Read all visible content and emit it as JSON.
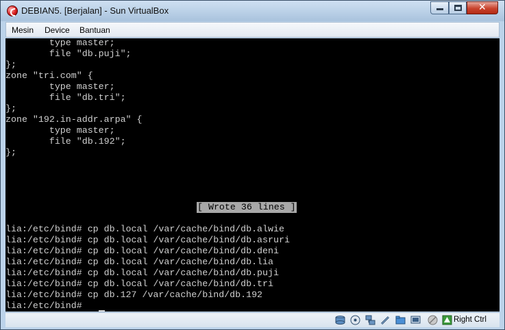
{
  "window": {
    "title": "DEBIAN5. [Berjalan] - Sun VirtualBox"
  },
  "menu": {
    "items": [
      "Mesin",
      "Device",
      "Bantuan"
    ]
  },
  "terminal": {
    "lines": [
      "        type master;",
      "        file \"db.puji\";",
      "};",
      "zone \"tri.com\" {",
      "        type master;",
      "        file \"db.tri\";",
      "};",
      "zone \"192.in-addr.arpa\" {",
      "        type master;",
      "        file \"db.192\";",
      "};"
    ],
    "status_message": "[ Wrote 36 lines ]",
    "commands": [
      "lia:/etc/bind# cp db.local /var/cache/bind/db.alwie",
      "lia:/etc/bind# cp db.local /var/cache/bind/db.asruri",
      "lia:/etc/bind# cp db.local /var/cache/bind/db.deni",
      "lia:/etc/bind# cp db.local /var/cache/bind/db.lia",
      "lia:/etc/bind# cp db.local /var/cache/bind/db.puji",
      "lia:/etc/bind# cp db.local /var/cache/bind/db.tri",
      "lia:/etc/bind# cp db.127 /var/cache/bind/db.192",
      "lia:/etc/bind# "
    ]
  },
  "statusbar": {
    "icons": [
      "hard-disk-icon",
      "cd-dvd-icon",
      "network-icon",
      "usb-icon",
      "shared-folders-icon",
      "screen-icon",
      "mouse-integration-icon",
      "host-key-icon"
    ],
    "host_key": "Right Ctrl"
  },
  "colors": {
    "terminal_bg": "#000000",
    "terminal_fg": "#cfcfcf",
    "highlight_bg": "#a8a8a8",
    "close_button": "#c9432d"
  }
}
